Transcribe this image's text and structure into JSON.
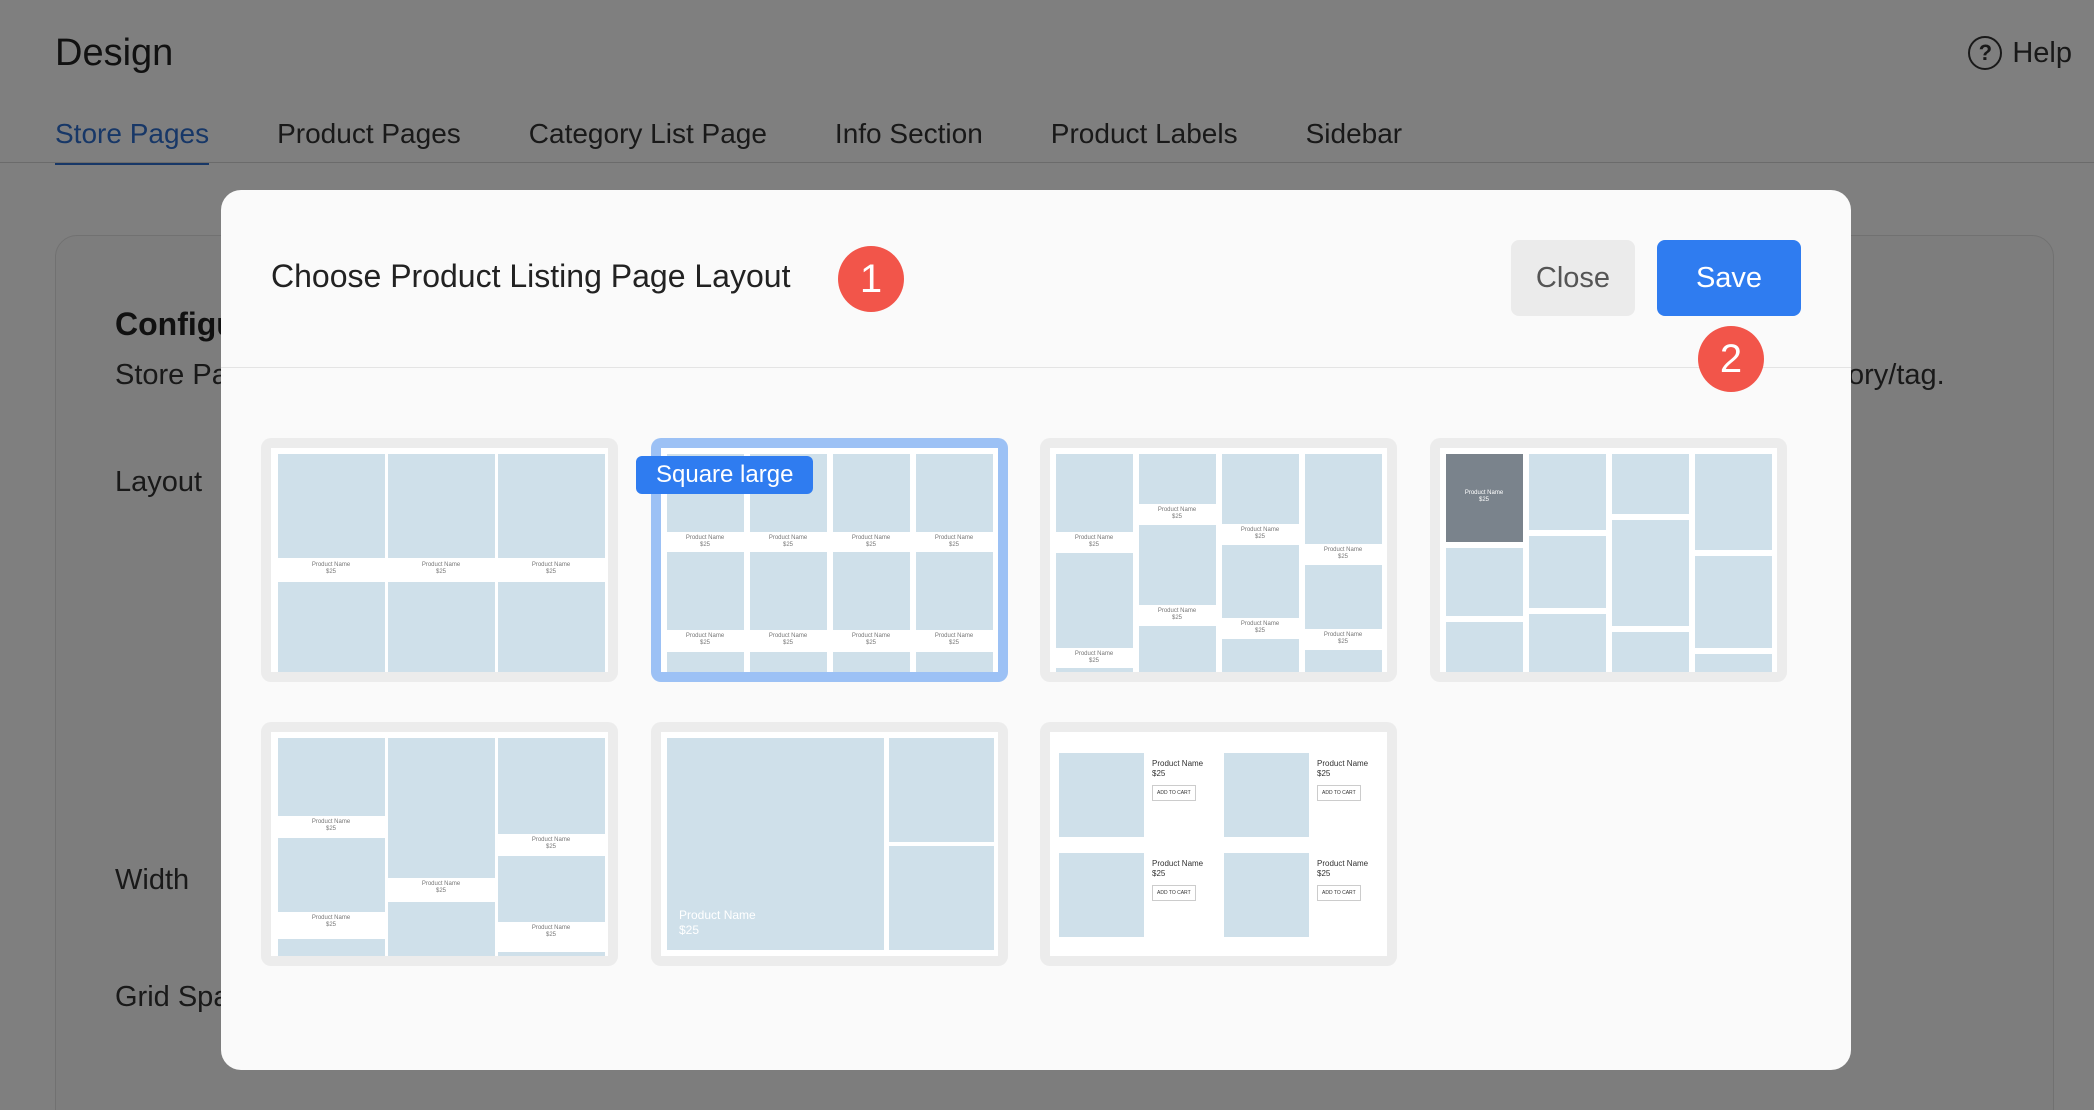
{
  "page": {
    "title": "Design",
    "help_label": "Help"
  },
  "tabs": [
    {
      "label": "Store Pages",
      "active": true
    },
    {
      "label": "Product Pages",
      "active": false
    },
    {
      "label": "Category List Page",
      "active": false
    },
    {
      "label": "Info Section",
      "active": false
    },
    {
      "label": "Product Labels",
      "active": false
    },
    {
      "label": "Sidebar",
      "active": false
    }
  ],
  "background": {
    "heading": "Configu",
    "description_start": "Store Pa",
    "description_end": "ory/tag.",
    "layout_label": "Layout",
    "width_label": "Width",
    "grid_spacing_label": "Grid Spa"
  },
  "modal": {
    "title": "Choose Product Listing Page Layout",
    "close_label": "Close",
    "save_label": "Save",
    "step1": "1",
    "step2": "2",
    "hovered_option_label": "Square large",
    "selected_option": 2
  },
  "placeholders": {
    "product_name": "Product Name",
    "price": "$25",
    "add_to_cart": "ADD TO CART"
  },
  "colors": {
    "accent": "#2f7cf0",
    "step_badge": "#f2554a",
    "selected_border": "#9cc1f5",
    "placeholder": "#cfe0ea"
  }
}
